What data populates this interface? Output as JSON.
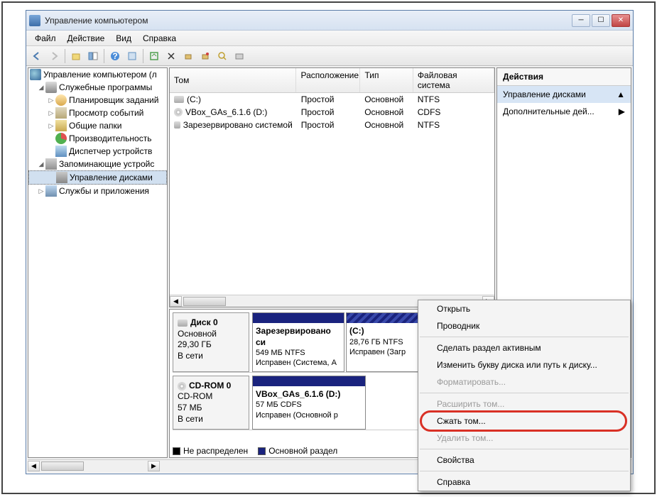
{
  "window": {
    "title": "Управление компьютером"
  },
  "menu": {
    "file": "Файл",
    "action": "Действие",
    "view": "Вид",
    "help": "Справка"
  },
  "tree": {
    "root": "Управление компьютером (л",
    "utilities": "Служебные программы",
    "scheduler": "Планировщик заданий",
    "events": "Просмотр событий",
    "shared": "Общие папки",
    "perf": "Производительность",
    "devmgr": "Диспетчер устройств",
    "storage": "Запоминающие устройс",
    "diskmgmt": "Управление дисками",
    "services": "Службы и приложения"
  },
  "columns": {
    "volume": "Том",
    "layout": "Расположение",
    "type": "Тип",
    "fs": "Файловая система"
  },
  "volumes": [
    {
      "name": "(C:)",
      "layout": "Простой",
      "type": "Основной",
      "fs": "NTFS",
      "icon": "disk"
    },
    {
      "name": "VBox_GAs_6.1.6 (D:)",
      "layout": "Простой",
      "type": "Основной",
      "fs": "CDFS",
      "icon": "cd"
    },
    {
      "name": "Зарезервировано системой",
      "layout": "Простой",
      "type": "Основной",
      "fs": "NTFS",
      "icon": "disk"
    }
  ],
  "disks": {
    "disk0": {
      "name": "Диск 0",
      "type": "Основной",
      "size": "29,30 ГБ",
      "status": "В сети",
      "parts": [
        {
          "title": "Зарезервировано си",
          "sub": "549 МБ NTFS",
          "status": "Исправен (Система, А"
        },
        {
          "title": "(C:)",
          "sub": "28,76 ГБ NTFS",
          "status": "Исправен (Загр"
        }
      ]
    },
    "cdrom": {
      "name": "CD-ROM 0",
      "type": "CD-ROM",
      "size": "57 МБ",
      "status": "В сети",
      "parts": [
        {
          "title": "VBox_GAs_6.1.6 (D:)",
          "sub": "57 МБ CDFS",
          "status": "Исправен (Основной р"
        }
      ]
    }
  },
  "legend": {
    "unalloc": "Не распределен",
    "primary": "Основной раздел"
  },
  "actions": {
    "header": "Действия",
    "diskmgmt": "Управление дисками",
    "more": "Дополнительные дей..."
  },
  "context": {
    "open": "Открыть",
    "explorer": "Проводник",
    "active": "Сделать раздел активным",
    "changeletter": "Изменить букву диска или путь к диску...",
    "format": "Форматировать...",
    "extend": "Расширить том...",
    "shrink": "Сжать том...",
    "delete": "Удалить том...",
    "properties": "Свойства",
    "help": "Справка"
  }
}
